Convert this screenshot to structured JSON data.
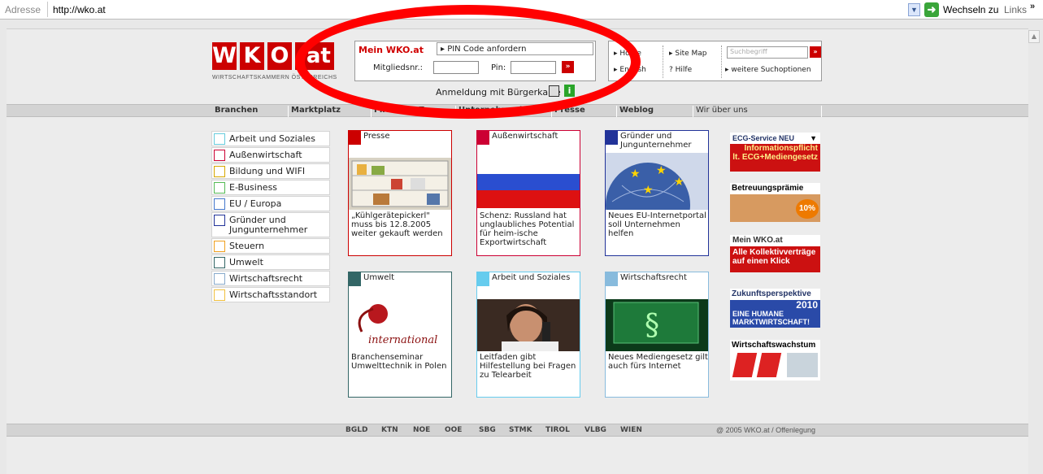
{
  "browser": {
    "address_label": "Adresse",
    "url": "http://wko.at",
    "go_label": "Wechseln zu",
    "links_label": "Links",
    "more": "»"
  },
  "logo": {
    "letters": [
      "W",
      "K",
      "O"
    ],
    "suffix": ".at",
    "subtitle": "WIRTSCHAFTSKAMMERN ÖSTERREICHS"
  },
  "login": {
    "title": "Mein WKO.at",
    "pin_request": "PIN Code anfordern",
    "member_label": "Mitgliedsnr.:",
    "pin_label": "Pin:",
    "buergerkarte": "Anmeldung mit Bürgerkarte"
  },
  "quicklinks": {
    "home": "Home",
    "english": "English",
    "sitemap": "Site Map",
    "help": "Hilfe",
    "search_placeholder": "Suchbegriff",
    "more_search": "weitere Suchoptionen"
  },
  "nav": [
    "Branchen",
    "Marktplatz",
    "Firmen A-Z",
    "Unternehmerin",
    "Presse",
    "Weblog",
    "Wir über uns"
  ],
  "sidebar": [
    {
      "label": "Arbeit und Soziales",
      "color": "#66ccdd"
    },
    {
      "label": "Außenwirtschaft",
      "color": "#cc0033"
    },
    {
      "label": "Bildung und WIFI",
      "color": "#d7a800"
    },
    {
      "label": "E-Business",
      "color": "#55bb55"
    },
    {
      "label": "EU / Europa",
      "color": "#4477cc"
    },
    {
      "label": "Gründer und Jungunternehmer",
      "color": "#223399"
    },
    {
      "label": "Steuern",
      "color": "#f0a020"
    },
    {
      "label": "Umwelt",
      "color": "#336666"
    },
    {
      "label": "Wirtschaftsrecht",
      "color": "#88aacc"
    },
    {
      "label": "Wirtschaftsstandort",
      "color": "#f0c040"
    }
  ],
  "tiles": [
    {
      "title": "Presse",
      "color": "#cc0000",
      "text": "„Kühlgerätepickerl\" muss bis 12.8.2005 weiter gekauft werden",
      "image": "fridge-photo"
    },
    {
      "title": "Außenwirtschaft",
      "color": "#cc0033",
      "text": "Schenz: Russland hat unglaubliches Potential für heim-ische Exportwirtschaft",
      "image": "russia-flag"
    },
    {
      "title": "Gründer und Jungunternehmer",
      "color": "#223399",
      "text": "Neues EU-Internetportal soll Unternehmen helfen",
      "image": "globe-eu-stars"
    },
    {
      "title": "Umwelt",
      "color": "#336666",
      "text": "Branchenseminar Umwelttechnik in Polen",
      "image": "international-logo"
    },
    {
      "title": "Arbeit und Soziales",
      "color": "#66ccee",
      "text": "Leitfaden gibt Hilfestellung bei Fragen zu Telearbeit",
      "image": "woman-phone-photo"
    },
    {
      "title": "Wirtschaftsrecht",
      "color": "#88bbdd",
      "text": "Neues Mediengesetz gilt auch fürs Internet",
      "image": "paragraph-screen"
    }
  ],
  "ads": {
    "ecg_title": "ECG-Service NEU",
    "ecg_text1": "Informationspflicht",
    "ecg_text2": "lt. ECG+Mediengesetz",
    "praemie_title": "Betreuungsprämie",
    "praemie_badge": "10%",
    "meinwko_title": "Mein WKO.at",
    "meinwko_text": "Alle Kollektivverträge auf einen Klick",
    "zukunft_title": "Zukunftsperspektive",
    "zukunft_year": "2010",
    "zukunft_text": "EINE HUMANE MARKTWIRTSCHAFT!",
    "wachstum_title": "Wirtschaftswachstum"
  },
  "footer": {
    "regions": [
      "BGLD",
      "KTN",
      "NOE",
      "OOE",
      "SBG",
      "STMK",
      "TIROL",
      "VLBG",
      "WIEN"
    ],
    "copyright": "@ 2005 WKO.at / Offenlegung"
  }
}
